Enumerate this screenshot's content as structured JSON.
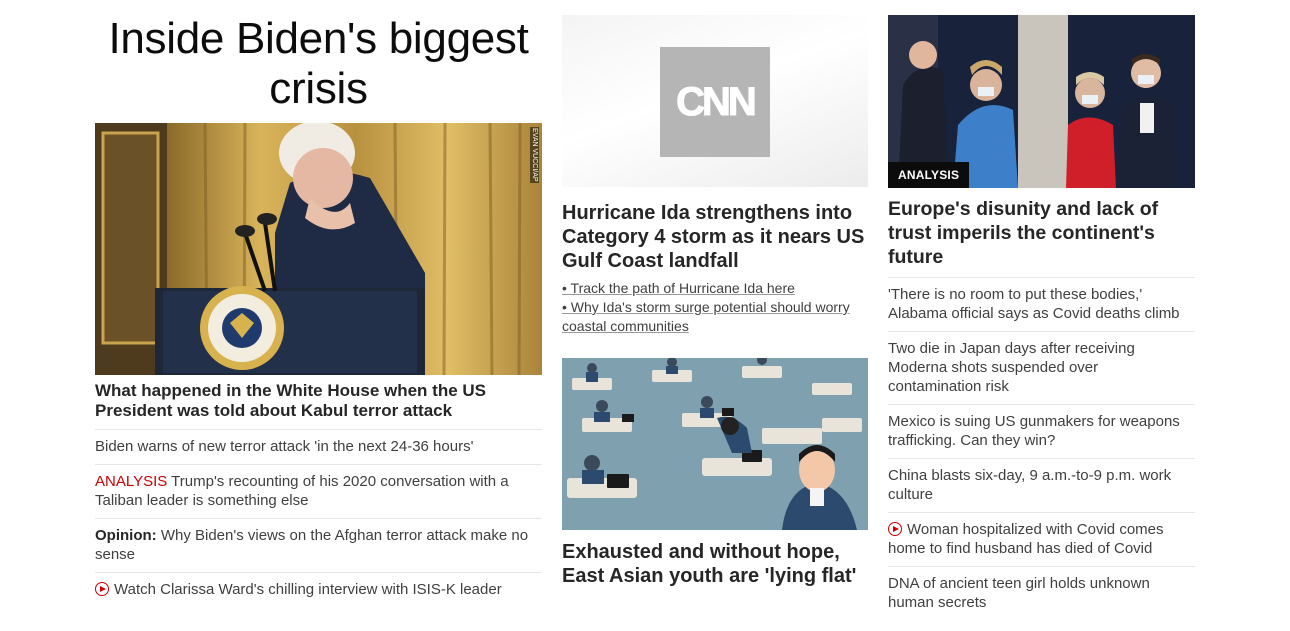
{
  "col1": {
    "headline": "Inside Biden's biggest crisis",
    "image_alt": "Biden at podium",
    "image_credit": "EVAN VUCCI/AP",
    "lead_title": "What happened in the White House when the US President was told about Kabul terror attack",
    "items": [
      {
        "text": "Biden warns of new terror attack 'in the next 24-36 hours'"
      },
      {
        "kicker": "ANALYSIS",
        "text": " Trump's recounting of his 2020 conversation with a Taliban leader is something else"
      },
      {
        "kicker": "Opinion:",
        "text": " Why Biden's views on the Afghan terror attack make no sense"
      },
      {
        "icon": "play-icon",
        "text": "Watch Clarissa Ward's chilling interview with ISIS-K leader"
      }
    ]
  },
  "col2": {
    "logo_text": "CNN",
    "title1": "Hurricane Ida strengthens into Category 4 storm as it nears US Gulf Coast landfall",
    "bullets": [
      "• Track the path of Hurricane Ida here",
      "• Why Ida's storm surge potential should worry coastal communities"
    ],
    "title2": "Exhausted and without hope, East Asian youth are 'lying flat'"
  },
  "col3": {
    "badge": "ANALYSIS",
    "title": "Europe's disunity and lack of trust imperils the continent's future",
    "items": [
      {
        "text": "'There is no room to put these bodies,' Alabama official says as Covid deaths climb"
      },
      {
        "text": "Two die in Japan days after receiving Moderna shots suspended over contamination risk"
      },
      {
        "text": "Mexico is suing US gunmakers for weapons trafficking. Can they win?"
      },
      {
        "text": "China blasts six-day, 9 a.m.-to-9 p.m. work culture"
      },
      {
        "icon": "play-icon",
        "text": "Woman hospitalized with Covid comes home to find husband has died of Covid"
      },
      {
        "text": "DNA of ancient teen girl holds unknown human secrets"
      }
    ]
  },
  "colors": {
    "accent": "#cc0000",
    "text": "#262626",
    "divider": "#e6e6e6"
  }
}
